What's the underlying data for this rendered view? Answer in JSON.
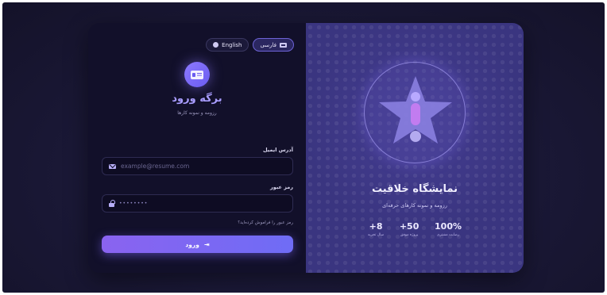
{
  "language_switcher": {
    "english_label": "English",
    "persian_label": "فارسی",
    "active": "فارسی"
  },
  "login": {
    "title": "برگه ورود",
    "subtitle": "رزومه و نمونه کارها",
    "email_label": "آدرس ایمیل",
    "email_placeholder": "example@resume.com",
    "password_label": "رمز عبور",
    "password_masked": "••••••••",
    "forgot_link": "رمز عبور را فراموش کرده‌اید؟",
    "submit_label": "ورود"
  },
  "showcase": {
    "title": "نمایشگاه خلاقیت",
    "subtitle": "رزومه و نمونه کارهای حرفه‌ای",
    "stats": [
      {
        "value": "100%",
        "label": "رضایت مشتری"
      },
      {
        "value": "50+",
        "label": "پروژه موفق"
      },
      {
        "value": "8+",
        "label": "سال تجربه"
      }
    ]
  },
  "colors": {
    "accent": "#8a76ff",
    "button_gradient_start": "#8a63f0",
    "button_gradient_end": "#6f6cf5",
    "form_panel_bg": "#12102a",
    "showcase_panel_bg": "#3a3580"
  },
  "icons": {
    "logo": "id-card-icon",
    "email": "mail-icon",
    "password": "lock-icon",
    "submit": "login-arrow-icon",
    "english": "globe-icon",
    "persian": "flag-icon",
    "emblem": "star-exclamation-icon"
  }
}
